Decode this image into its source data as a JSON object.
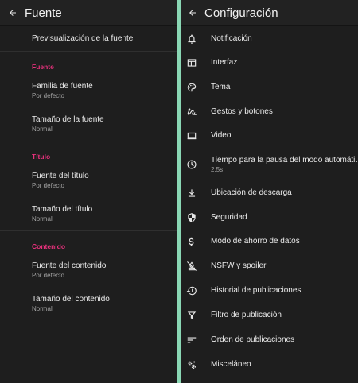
{
  "left": {
    "title": "Fuente",
    "preview": "Previsualización de la fuente",
    "sections": [
      {
        "category": "Fuente",
        "items": [
          {
            "title": "Familia de fuente",
            "sub": "Por defecto"
          },
          {
            "title": "Tamaño de la fuente",
            "sub": "Normal"
          }
        ]
      },
      {
        "category": "Título",
        "items": [
          {
            "title": "Fuente del título",
            "sub": "Por defecto"
          },
          {
            "title": "Tamaño del título",
            "sub": "Normal"
          }
        ]
      },
      {
        "category": "Contenido",
        "items": [
          {
            "title": "Fuente del contenido",
            "sub": "Por defecto"
          },
          {
            "title": "Tamaño del contenido",
            "sub": "Normal"
          }
        ]
      }
    ]
  },
  "right": {
    "title": "Configuración",
    "items": [
      {
        "label": "Notificación",
        "icon": "bell-icon"
      },
      {
        "label": "Interfaz",
        "icon": "interface-icon"
      },
      {
        "label": "Tema",
        "icon": "palette-icon"
      },
      {
        "label": "Gestos y botones",
        "icon": "gesture-icon"
      },
      {
        "label": "Video",
        "icon": "video-icon"
      },
      {
        "label": "Tiempo para la pausa del modo automáti…",
        "sub": "2.5s",
        "icon": "clock-icon"
      },
      {
        "label": "Ubicación de descarga",
        "icon": "download-icon"
      },
      {
        "label": "Seguridad",
        "icon": "shield-icon"
      },
      {
        "label": "Modo de ahorro de datos",
        "icon": "dollar-icon"
      },
      {
        "label": "NSFW y spoiler",
        "icon": "nsfw-icon"
      },
      {
        "label": "Historial de publicaciones",
        "icon": "history-icon"
      },
      {
        "label": "Filtro de publicación",
        "icon": "filter-icon"
      },
      {
        "label": "Orden de publicaciones",
        "icon": "sort-icon"
      },
      {
        "label": "Misceláneo",
        "icon": "gears-icon"
      }
    ]
  },
  "colors": {
    "background": "#1e1e1e",
    "accent": "#e7317c",
    "divider": "#8ad7b4",
    "text": "#ececec",
    "subtext": "#a3a3a3"
  }
}
